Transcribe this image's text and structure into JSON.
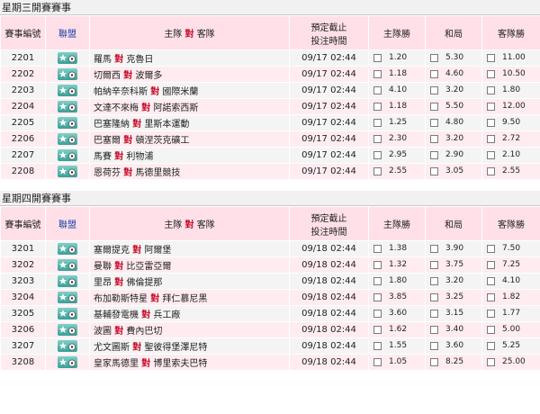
{
  "headers": {
    "match_no": "賽事編號",
    "league": "聯盟",
    "home": "主隊",
    "vs": "對",
    "away": "客隊",
    "close_line1": "預定截止",
    "close_line2": "投注時間",
    "home_win": "主隊勝",
    "draw": "和局",
    "away_win": "客隊勝"
  },
  "sections": [
    {
      "title": "星期三開賽賽事",
      "rows": [
        {
          "no": "2201",
          "home": "羅馬",
          "away": "克魯日",
          "time": "09/17 02:44",
          "h": "1.20",
          "d": "5.30",
          "a": "11.00"
        },
        {
          "no": "2202",
          "home": "切爾西",
          "away": "波爾多",
          "time": "09/17 02:44",
          "h": "1.18",
          "d": "4.60",
          "a": "10.50"
        },
        {
          "no": "2203",
          "home": "帕納辛奈科斯",
          "away": "國際米蘭",
          "time": "09/17 02:44",
          "h": "4.10",
          "d": "3.20",
          "a": "1.80"
        },
        {
          "no": "2204",
          "home": "文達不來梅",
          "away": "阿諾索西斯",
          "time": "09/17 02:44",
          "h": "1.18",
          "d": "5.50",
          "a": "12.00"
        },
        {
          "no": "2205",
          "home": "巴塞隆納",
          "away": "里斯本運動",
          "time": "09/17 02:44",
          "h": "1.25",
          "d": "4.80",
          "a": "9.50"
        },
        {
          "no": "2206",
          "home": "巴塞爾",
          "away": "頓涅茨克礦工",
          "time": "09/17 02:44",
          "h": "2.30",
          "d": "3.20",
          "a": "2.72"
        },
        {
          "no": "2207",
          "home": "馬賽",
          "away": "利物浦",
          "time": "09/17 02:44",
          "h": "2.95",
          "d": "2.90",
          "a": "2.10"
        },
        {
          "no": "2208",
          "home": "恩荷芬",
          "away": "馬德里競技",
          "time": "09/17 02:44",
          "h": "2.55",
          "d": "3.05",
          "a": "2.55"
        }
      ]
    },
    {
      "title": "星期四開賽賽事",
      "rows": [
        {
          "no": "3201",
          "home": "塞爾提克",
          "away": "阿爾堡",
          "time": "09/18 02:44",
          "h": "1.38",
          "d": "3.90",
          "a": "7.50"
        },
        {
          "no": "3202",
          "home": "曼聯",
          "away": "比亞雷亞爾",
          "time": "09/18 02:44",
          "h": "1.32",
          "d": "3.75",
          "a": "7.25"
        },
        {
          "no": "3203",
          "home": "里昂",
          "away": "佛倫提那",
          "time": "09/18 02:44",
          "h": "1.80",
          "d": "3.20",
          "a": "4.10"
        },
        {
          "no": "3204",
          "home": "布加勒斯特星",
          "away": "拜仁慕尼黑",
          "time": "09/18 02:44",
          "h": "3.85",
          "d": "3.25",
          "a": "1.82"
        },
        {
          "no": "3205",
          "home": "基輔發電機",
          "away": "兵工廠",
          "time": "09/18 02:44",
          "h": "3.60",
          "d": "3.15",
          "a": "1.77"
        },
        {
          "no": "3206",
          "home": "波圖",
          "away": "費內巴切",
          "time": "09/18 02:44",
          "h": "1.62",
          "d": "3.40",
          "a": "5.00"
        },
        {
          "no": "3207",
          "home": "尤文圖斯",
          "away": "聖彼得堡澤尼特",
          "time": "09/18 02:44",
          "h": "1.55",
          "d": "3.60",
          "a": "5.25"
        },
        {
          "no": "3208",
          "home": "皇家馬德里",
          "away": "博里索夫巴特",
          "time": "09/18 02:44",
          "h": "1.05",
          "d": "8.25",
          "a": "25.00"
        }
      ]
    }
  ]
}
